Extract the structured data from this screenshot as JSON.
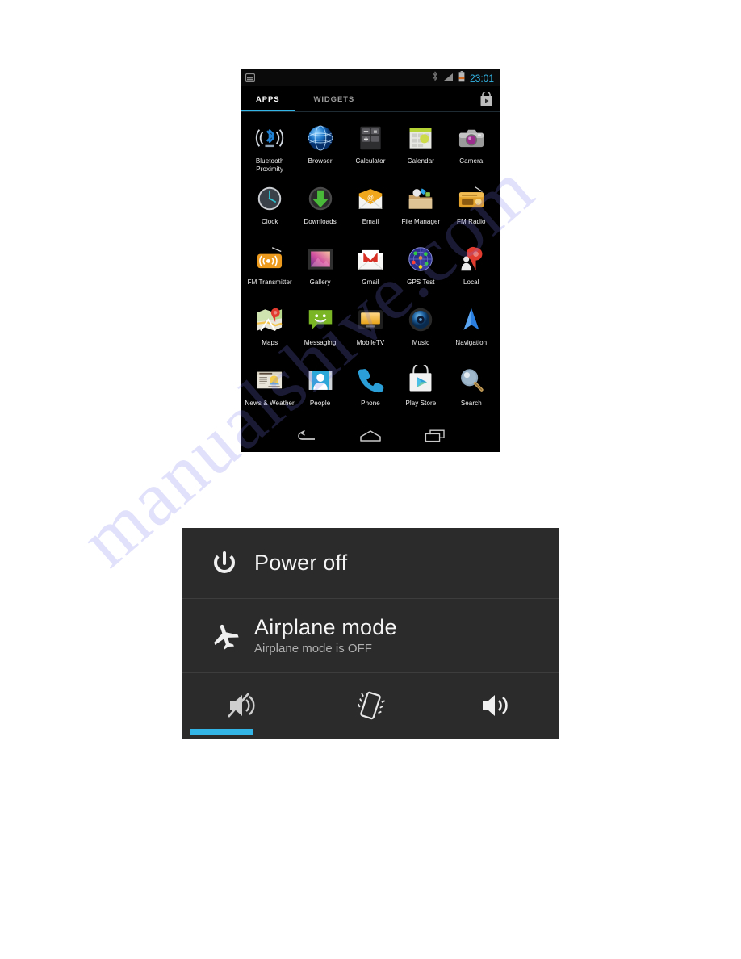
{
  "page": {
    "watermark_text": "manualshive.com",
    "background_color": "#ffffff",
    "accent_color": "#33b5e5"
  },
  "phone": {
    "status_bar": {
      "left_icons": [
        "sd-card-icon"
      ],
      "right_icons": [
        "bluetooth-icon",
        "signal-bars-icon",
        "battery-icon"
      ],
      "clock": "23:01",
      "clock_color": "#33b5e5"
    },
    "tabs": [
      {
        "label": "APPS",
        "active": true
      },
      {
        "label": "WIDGETS",
        "active": false
      }
    ],
    "play_store_badge": "play-store-bag-icon",
    "apps": [
      {
        "label": "Bluetooth Proximity",
        "icon": "bluetooth-proximity-icon"
      },
      {
        "label": "Browser",
        "icon": "browser-globe-icon"
      },
      {
        "label": "Calculator",
        "icon": "calculator-icon"
      },
      {
        "label": "Calendar",
        "icon": "calendar-icon"
      },
      {
        "label": "Camera",
        "icon": "camera-icon"
      },
      {
        "label": "Clock",
        "icon": "clock-icon"
      },
      {
        "label": "Downloads",
        "icon": "downloads-arrow-icon"
      },
      {
        "label": "Email",
        "icon": "email-envelope-icon"
      },
      {
        "label": "File Manager",
        "icon": "file-manager-icon"
      },
      {
        "label": "FM Radio",
        "icon": "fm-radio-icon"
      },
      {
        "label": "FM Transmitter",
        "icon": "fm-transmitter-icon"
      },
      {
        "label": "Gallery",
        "icon": "gallery-photo-icon"
      },
      {
        "label": "Gmail",
        "icon": "gmail-envelope-icon"
      },
      {
        "label": "GPS Test",
        "icon": "gps-test-icon"
      },
      {
        "label": "Local",
        "icon": "local-map-pin-icon"
      },
      {
        "label": "Maps",
        "icon": "maps-icon"
      },
      {
        "label": "Messaging",
        "icon": "messaging-bubble-icon"
      },
      {
        "label": "MobileTV",
        "icon": "mobile-tv-icon"
      },
      {
        "label": "Music",
        "icon": "music-speaker-icon"
      },
      {
        "label": "Navigation",
        "icon": "navigation-arrow-icon"
      },
      {
        "label": "News & Weather",
        "icon": "news-weather-icon"
      },
      {
        "label": "People",
        "icon": "people-contact-icon"
      },
      {
        "label": "Phone",
        "icon": "phone-handset-icon"
      },
      {
        "label": "Play Store",
        "icon": "play-store-icon"
      },
      {
        "label": "Search",
        "icon": "search-magnifier-icon"
      }
    ],
    "nav_bar": [
      {
        "name": "back",
        "icon": "back-arrow-icon"
      },
      {
        "name": "home",
        "icon": "home-icon"
      },
      {
        "name": "recents",
        "icon": "recent-apps-icon"
      }
    ]
  },
  "power_dialog": {
    "power_off": {
      "title": "Power off",
      "icon": "power-icon"
    },
    "airplane_mode": {
      "title": "Airplane mode",
      "subtitle": "Airplane mode is OFF",
      "icon": "airplane-icon"
    },
    "ringer_modes": [
      {
        "name": "silent",
        "icon": "mute-speaker-icon",
        "selected": true
      },
      {
        "name": "vibrate",
        "icon": "vibrate-icon",
        "selected": false
      },
      {
        "name": "sound",
        "icon": "speaker-on-icon",
        "selected": false
      }
    ]
  }
}
